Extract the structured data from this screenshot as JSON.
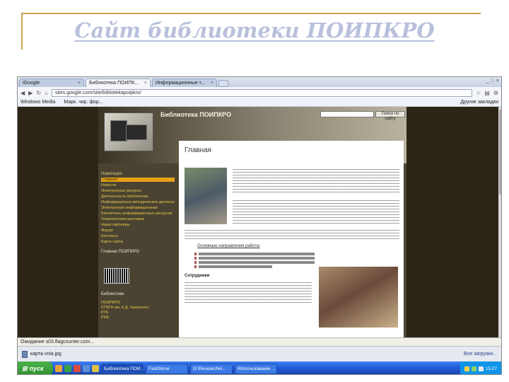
{
  "slide": {
    "title": "Сайт библиотеки ПОИПКРО"
  },
  "browser": {
    "tabs": [
      {
        "label": "iGoogle"
      },
      {
        "label": "Библиотека ПОИПК..."
      },
      {
        "label": "Информационные т..."
      }
    ],
    "address": "sites.google.com/site/bibliotekapoipkro/",
    "bookmarks": [
      "Windows Media",
      "Марк. чир. фор..."
    ],
    "bookmarks_right": "Другие закладки",
    "status_text": "Ожидание s03.flagcounter.com...",
    "download_file": "карта vnia.jpg",
    "download_all": "Все загрузки..."
  },
  "site": {
    "name": "Библиотека ПОИПКРО",
    "search_button": "Поиск по сайту",
    "nav_heading": "Навигация",
    "nav_items": [
      "Главная",
      "Новости",
      "Электронные ресурсы",
      "Деятельность библиотеки",
      "Информационно-методическая деятельность",
      "Электронная информационная",
      "Бюллетень информационных ресурсов",
      "Тематические выставки",
      "Наши партнеры",
      "Форум",
      "Контакты",
      "Карта сайта"
    ],
    "nav_sub": "Главная ПОИПКРО",
    "nav_links_heading": "Библиотеки",
    "nav_links": [
      "ПОИПКРО",
      "СПбГБ им. К.Д. Ушинского",
      "РГБ",
      "РНБ"
    ],
    "page_title": "Главная",
    "subhead": "Основные направления работы",
    "staff_title": "Сотрудники"
  },
  "taskbar": {
    "start": "пуск",
    "tasks": [
      "Библиотека ПОИ...",
      "FastStone",
      "D:\\Researchin...",
      "Использование ..."
    ],
    "clock": "15:27"
  }
}
